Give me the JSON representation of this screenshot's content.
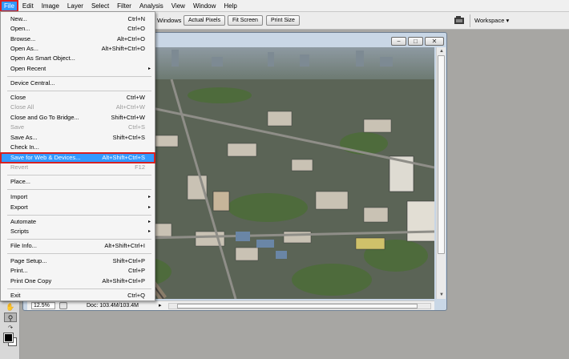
{
  "menubar": {
    "items": [
      "File",
      "Edit",
      "Image",
      "Layer",
      "Select",
      "Filter",
      "Analysis",
      "View",
      "Window",
      "Help"
    ]
  },
  "optionsbar": {
    "partial_label": "Windows",
    "buttons": [
      "Actual Pixels",
      "Fit Screen",
      "Print Size"
    ],
    "workspace_label": "Workspace ▾"
  },
  "document": {
    "zoom": "12.5%",
    "doc_size": "Doc: 103.4M/103.4M",
    "status_arrow": "▸",
    "image_description_icon": "aerial-city-photo"
  },
  "file_menu": {
    "items": [
      {
        "label": "New...",
        "shortcut": "Ctrl+N",
        "state": "normal"
      },
      {
        "label": "Open...",
        "shortcut": "Ctrl+O",
        "state": "normal"
      },
      {
        "label": "Browse...",
        "shortcut": "Alt+Ctrl+O",
        "state": "normal"
      },
      {
        "label": "Open As...",
        "shortcut": "Alt+Shift+Ctrl+O",
        "state": "normal"
      },
      {
        "label": "Open As Smart Object...",
        "shortcut": "",
        "state": "normal"
      },
      {
        "label": "Open Recent",
        "shortcut": "",
        "state": "submenu"
      },
      {
        "label": "Device Central...",
        "shortcut": "",
        "state": "normal"
      },
      {
        "label": "Close",
        "shortcut": "Ctrl+W",
        "state": "normal"
      },
      {
        "label": "Close All",
        "shortcut": "Alt+Ctrl+W",
        "state": "disabled"
      },
      {
        "label": "Close and Go To Bridge...",
        "shortcut": "Shift+Ctrl+W",
        "state": "normal"
      },
      {
        "label": "Save",
        "shortcut": "Ctrl+S",
        "state": "disabled"
      },
      {
        "label": "Save As...",
        "shortcut": "Shift+Ctrl+S",
        "state": "normal"
      },
      {
        "label": "Check In...",
        "shortcut": "",
        "state": "normal"
      },
      {
        "label": "Save for Web & Devices...",
        "shortcut": "Alt+Shift+Ctrl+S",
        "state": "highlight"
      },
      {
        "label": "Revert",
        "shortcut": "F12",
        "state": "disabled"
      },
      {
        "label": "Place...",
        "shortcut": "",
        "state": "normal"
      },
      {
        "label": "Import",
        "shortcut": "",
        "state": "submenu"
      },
      {
        "label": "Export",
        "shortcut": "",
        "state": "submenu"
      },
      {
        "label": "Automate",
        "shortcut": "",
        "state": "submenu"
      },
      {
        "label": "Scripts",
        "shortcut": "",
        "state": "submenu"
      },
      {
        "label": "File Info...",
        "shortcut": "Alt+Shift+Ctrl+I",
        "state": "normal"
      },
      {
        "label": "Page Setup...",
        "shortcut": "Shift+Ctrl+P",
        "state": "normal"
      },
      {
        "label": "Print...",
        "shortcut": "Ctrl+P",
        "state": "normal"
      },
      {
        "label": "Print One Copy",
        "shortcut": "Alt+Shift+Ctrl+P",
        "state": "normal"
      },
      {
        "label": "Exit",
        "shortcut": "Ctrl+Q",
        "state": "normal"
      }
    ],
    "submenu_arrow": "▸"
  },
  "colors": {
    "highlight": "#3399ff",
    "callout_red": "#d82020",
    "canvas_bg": "#a7a6a3"
  }
}
